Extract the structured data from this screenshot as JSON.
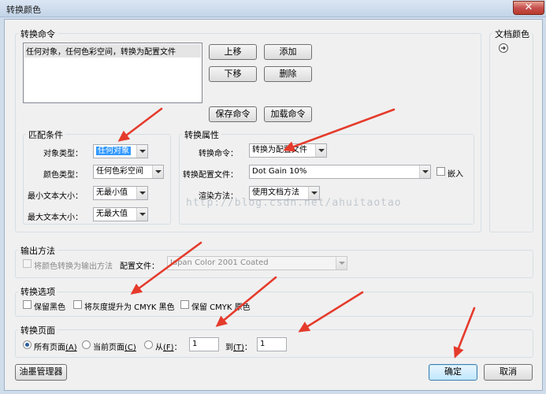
{
  "window": {
    "title": "转换颜色",
    "close_glyph": "✕"
  },
  "command_group": {
    "label": "转换命令",
    "list_items": [
      "任何对象，任何色彩空间，转换为配置文件"
    ],
    "buttons": {
      "up": "上移",
      "add": "添加",
      "down": "下移",
      "delete": "删除",
      "save": "保存命令",
      "load": "加载命令"
    }
  },
  "doc_colors": {
    "label": "文档颜色",
    "icon": "arrow-right-circle-icon"
  },
  "match_group": {
    "label": "匹配条件",
    "object_type_label": "对象类型：",
    "object_type_value": "任何对象",
    "color_type_label": "颜色类型：",
    "color_type_value": "任何色彩空间",
    "min_text_label": "最小文本大小：",
    "min_text_value": "无最小值",
    "max_text_label": "最大文本大小：",
    "max_text_value": "无最大值"
  },
  "convert_props": {
    "label": "转换属性",
    "command_label": "转换命令：",
    "command_value": "转换为配置文件",
    "profile_label": "转换配置文件：",
    "profile_value": "Dot Gain 10%",
    "embed_label": "嵌入",
    "render_label": "渲染方法：",
    "render_value": "使用文档方法"
  },
  "watermark": "http://blog.csdn.net/ahuitaotao",
  "output_group": {
    "label": "输出方法",
    "convert_output_label": "将颜色转换为输出方法",
    "profile_label": "配置文件：",
    "profile_value": "Japan Color 2001 Coated"
  },
  "options_group": {
    "label": "转换选项",
    "keep_black": "保留黑色",
    "promote_gray_pre": "将灰度提升为 CMYK 黑色",
    "keep_cmyk": "保留 CMYK 原色"
  },
  "pages_group": {
    "label": "转换页面",
    "all_pages": "所有页面",
    "all_pages_key": "(A)",
    "current_page": "当前页面",
    "current_page_key": "(C)",
    "from": "从",
    "from_key": "(F)",
    "from_colon": "：",
    "from_value": "1",
    "to": "到",
    "to_key": "(T)",
    "to_colon": "：",
    "to_value": "1"
  },
  "footer": {
    "ink_manager": "油墨管理器",
    "ok": "确定",
    "cancel": "取消"
  },
  "colors": {
    "annotation_arrow": "#e53b2c",
    "selection": "#3399ff"
  }
}
